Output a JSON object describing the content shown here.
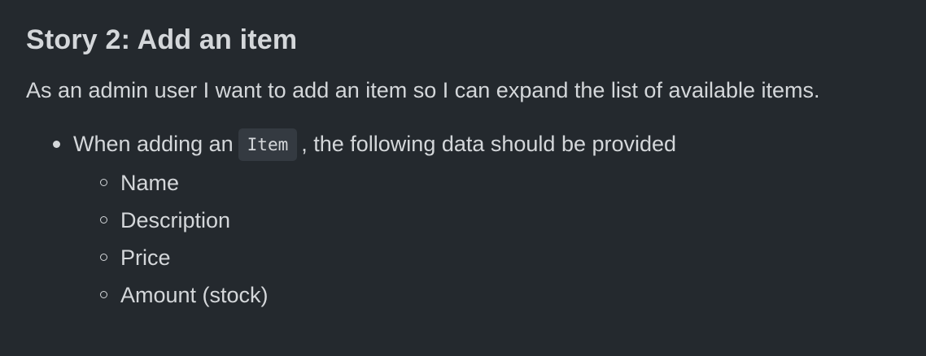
{
  "story": {
    "title": "Story 2: Add an item",
    "description": "As an admin user I want to add an item so I can expand the list of available items.",
    "bullet": {
      "text_before": "When adding an",
      "code": "Item",
      "text_after": ", the following data should be provided"
    },
    "fields": [
      "Name",
      "Description",
      "Price",
      "Amount (stock)"
    ]
  }
}
